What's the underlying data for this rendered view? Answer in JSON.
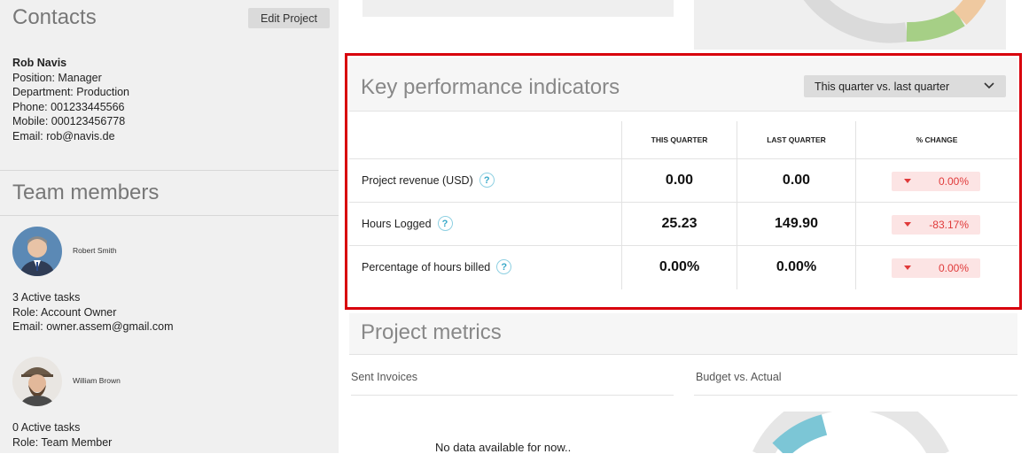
{
  "sidebar": {
    "contacts_title": "Contacts",
    "edit_button": "Edit Project",
    "contact": {
      "name": "Rob Navis",
      "position": "Position: Manager",
      "department": "Department: Production",
      "phone": "Phone: 001233445566",
      "mobile": "Mobile: 000123456778",
      "email": "Email: rob@navis.de"
    },
    "team_title": "Team members",
    "members": [
      {
        "name": "Robert Smith",
        "tasks": "3 Active tasks",
        "role": "Role: Account Owner",
        "email": "Email: owner.assem@gmail.com"
      },
      {
        "name": "William Brown",
        "tasks": "0 Active tasks",
        "role": "Role: Team Member"
      }
    ]
  },
  "kpi": {
    "title": "Key performance indicators",
    "period_select": "This quarter vs. last quarter",
    "columns": [
      "THIS QUARTER",
      "LAST QUARTER",
      "% CHANGE"
    ],
    "rows": [
      {
        "label": "Project revenue (USD)",
        "this": "0.00",
        "last": "0.00",
        "change": "0.00%"
      },
      {
        "label": "Hours Logged",
        "this": "25.23",
        "last": "149.90",
        "change": "-83.17%"
      },
      {
        "label": "Percentage of hours billed",
        "this": "0.00%",
        "last": "0.00%",
        "change": "0.00%"
      }
    ],
    "help_glyph": "?",
    "highlight_color": "#d8000c"
  },
  "metrics": {
    "title": "Project metrics",
    "sent_invoices": "Sent Invoices",
    "budget_vs_actual": "Budget vs. Actual",
    "no_data": "No data available for now.."
  }
}
